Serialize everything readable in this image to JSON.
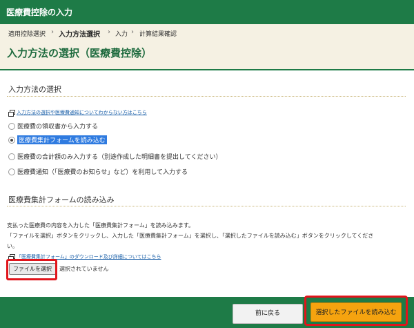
{
  "app": {
    "title": "医療費控除の入力"
  },
  "breadcrumb": [
    {
      "label": "適用控除選択"
    },
    {
      "label": "入力方法選択"
    },
    {
      "label": "入力"
    },
    {
      "label": "計算結果確認"
    }
  ],
  "breadcrumb_sep": "›",
  "page": {
    "title": "入力方法の選択（医療費控除）"
  },
  "method_section": {
    "title": "入力方法の選択",
    "help_link": "入力方法の選択や医療費通知についてわからない方はこちら",
    "options": [
      {
        "label": "医療費の領収書から入力する",
        "selected": false
      },
      {
        "label": "医療費集計フォームを読み込む",
        "selected": true
      },
      {
        "label": "医療費の合計額のみ入力する（別途作成した明細書を提出してください）",
        "selected": false
      },
      {
        "label": "医療費通知（「医療費のお知らせ」など）を利用して入力する",
        "selected": false
      }
    ]
  },
  "form_section": {
    "title": "医療費集計フォームの読み込み",
    "line1": "支払った医療費の内容を入力した「医療費集計フォーム」を読み込みます。",
    "line2": "「ファイルを選択」ボタンをクリックし、入力した「医療費集計フォーム」を選択し、「選択したファイルを読み込む」ボタンをクリックしてくださ",
    "line3": "い。",
    "download_link": "「医療費集計フォーム」のダウンロード及び詳細についてはこちら",
    "file_button": "ファイルを選択",
    "file_status": "選択されていません"
  },
  "footer": {
    "back_button": "前に戻る",
    "next_button": "選択したファイルを読み込む"
  },
  "colors": {
    "brand_green": "#1e7b47",
    "beige": "#f5f1e3",
    "highlight_red": "#e1141b",
    "primary_orange": "#f5a30f"
  }
}
